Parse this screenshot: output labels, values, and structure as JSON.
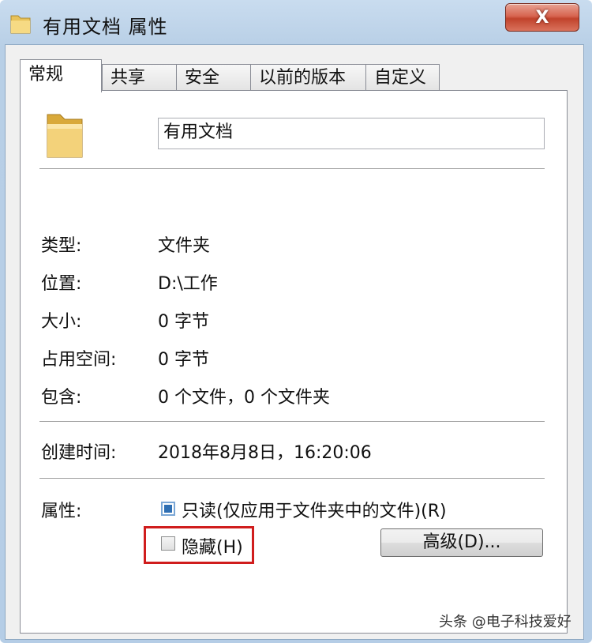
{
  "window": {
    "title": "有用文档 属性",
    "close_label": "X"
  },
  "tabs": [
    {
      "label": "常规",
      "active": true
    },
    {
      "label": "共享",
      "active": false
    },
    {
      "label": "安全",
      "active": false
    },
    {
      "label": "以前的版本",
      "active": false
    },
    {
      "label": "自定义",
      "active": false
    }
  ],
  "general": {
    "name_value": "有用文档",
    "rows": [
      {
        "label": "类型:",
        "value": "文件夹"
      },
      {
        "label": "位置:",
        "value": "D:\\工作"
      },
      {
        "label": "大小:",
        "value": "0 字节"
      },
      {
        "label": "占用空间:",
        "value": "0 字节"
      },
      {
        "label": "包含:",
        "value": "0 个文件，0 个文件夹"
      }
    ],
    "created": {
      "label": "创建时间:",
      "value": "2018年8月8日，16:20:06"
    },
    "attributes": {
      "label": "属性:",
      "readonly_label": "只读(仅应用于文件夹中的文件)(R)",
      "readonly_checked": true,
      "hidden_label": "隐藏(H)",
      "hidden_checked": false,
      "advanced_label": "高级(D)..."
    }
  },
  "icons": {
    "title": "folder-icon",
    "large": "folder-icon"
  },
  "colors": {
    "highlight": "#d01d1d",
    "close": "#c1432c"
  },
  "watermark": "头条 @电子科技爱好"
}
